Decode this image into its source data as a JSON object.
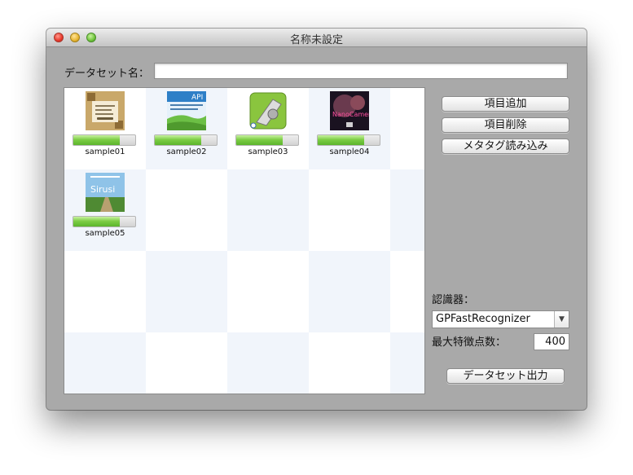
{
  "window": {
    "title": "名称未設定"
  },
  "dataset": {
    "label": "データセット名：",
    "value": ""
  },
  "items": [
    {
      "label": "sample01",
      "progress": 0.75,
      "icon": "sample01-thumbnail"
    },
    {
      "label": "sample02",
      "progress": 0.75,
      "icon": "sample02-thumbnail"
    },
    {
      "label": "sample03",
      "progress": 0.75,
      "icon": "sample03-thumbnail"
    },
    {
      "label": "sample04",
      "progress": 0.75,
      "icon": "sample04-thumbnail"
    },
    {
      "label": "sample05",
      "progress": 0.75,
      "icon": "sample05-thumbnail"
    }
  ],
  "thumbnails": {
    "sample02_text": "API",
    "sample04_text": "NanoCamera",
    "sample05_text": "Sirusi"
  },
  "buttons": {
    "add": "項目追加",
    "delete": "項目削除",
    "load_metatag": "メタタグ読み込み",
    "export": "データセット出力"
  },
  "recognizer": {
    "label": "認識器：",
    "selected": "GPFastRecognizer",
    "feature_label": "最大特徴点数：",
    "feature_value": "400"
  },
  "colors": {
    "progress": "#6fc43b",
    "window_bg": "#a9a9a9",
    "alt_cell": "#f1f5fb"
  }
}
